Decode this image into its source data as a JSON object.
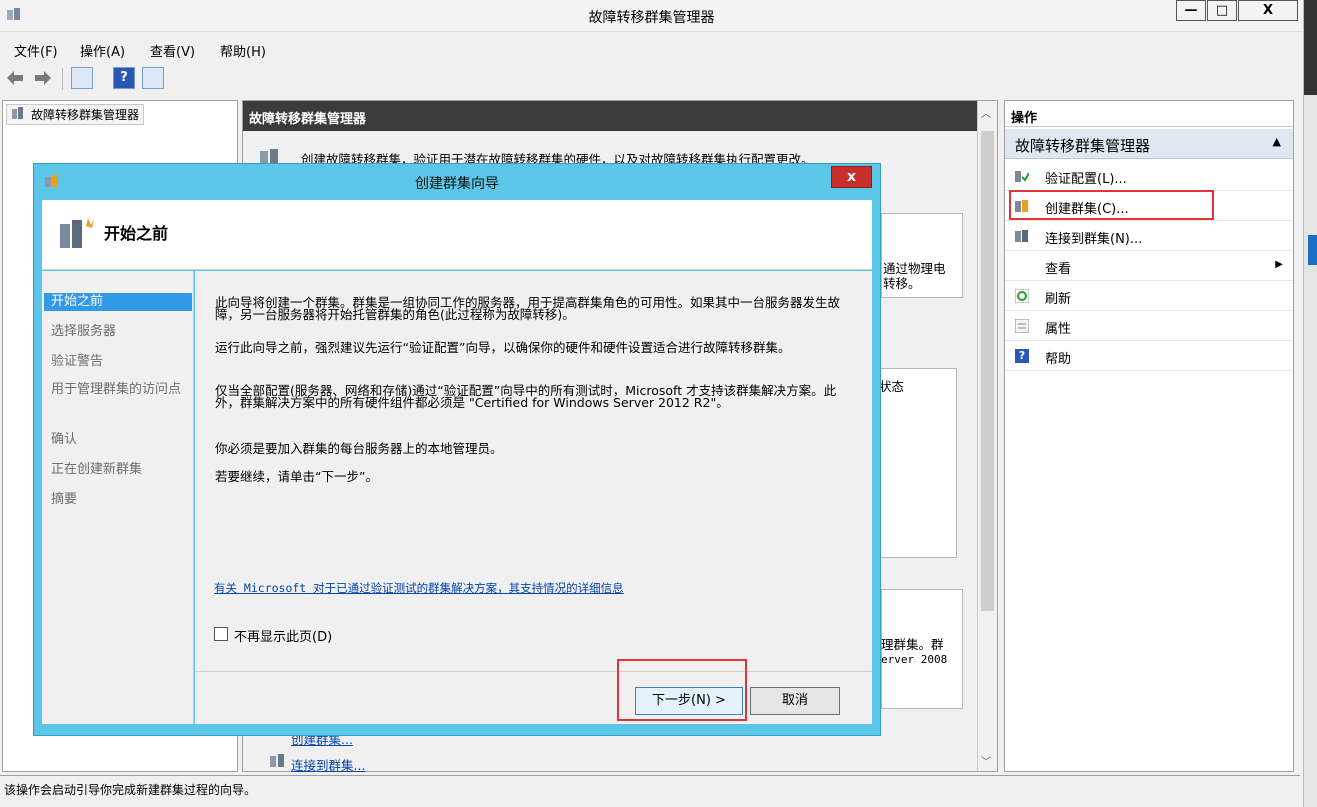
{
  "window": {
    "title": "故障转移群集管理器",
    "minimize": "—",
    "maximize": "□",
    "close": "X"
  },
  "menu": [
    "文件(F)",
    "操作(A)",
    "查看(V)",
    "帮助(H)"
  ],
  "tree": {
    "root": "故障转移群集管理器"
  },
  "center": {
    "header": "故障转移群集管理器",
    "intro": "创建故障转移群集，验证用于潜在故障转移群集的硬件，以及对故障转移群集执行配置更改。",
    "partial1a": "通过物理电",
    "partial1b": "转移。",
    "partial2": "状态",
    "partial3a": "理群集。群",
    "partial3b": "erver 2008",
    "link_create": "创建群集...",
    "link_connect": "连接到群集..."
  },
  "actions": {
    "header": "操作",
    "section": "故障转移群集管理器",
    "items": [
      {
        "label": "验证配置(L)...",
        "icon": "validate-icon"
      },
      {
        "label": "创建群集(C)...",
        "icon": "create-cluster-icon"
      },
      {
        "label": "连接到群集(N)...",
        "icon": "connect-icon"
      },
      {
        "label": "查看",
        "icon": "none"
      },
      {
        "label": "刷新",
        "icon": "refresh-icon"
      },
      {
        "label": "属性",
        "icon": "properties-icon"
      },
      {
        "label": "帮助",
        "icon": "help-icon"
      }
    ]
  },
  "status": "该操作会启动引导你完成新建群集过程的向导。",
  "dialog": {
    "title": "创建群集向导",
    "close": "x",
    "heading": "开始之前",
    "steps": [
      "开始之前",
      "选择服务器",
      "验证警告",
      "用于管理群集的访问点",
      "确认",
      "正在创建新群集",
      "摘要"
    ],
    "para1": "此向导将创建一个群集。群集是一组协同工作的服务器，用于提高群集角色的可用性。如果其中一台服务器发生故障，另一台服务器将开始托管群集的角色(此过程称为故障转移)。",
    "para2": "运行此向导之前，强烈建议先运行“验证配置”向导，以确保你的硬件和硬件设置适合进行故障转移群集。",
    "para3": "仅当全部配置(服务器、网络和存储)通过“验证配置”向导中的所有测试时，Microsoft 才支持该群集解决方案。此外，群集解决方案中的所有硬件组件都必须是 \"Certified for Windows Server 2012 R2\"。",
    "para4": "你必须是要加入群集的每台服务器上的本地管理员。",
    "para5": "若要继续，请单击“下一步”。",
    "link": "有关 Microsoft 对于已通过验证测试的群集解决方案，其支持情况的详细信息",
    "checkbox": "不再显示此页(D)",
    "next": "下一步(N) >",
    "cancel": "取消"
  }
}
